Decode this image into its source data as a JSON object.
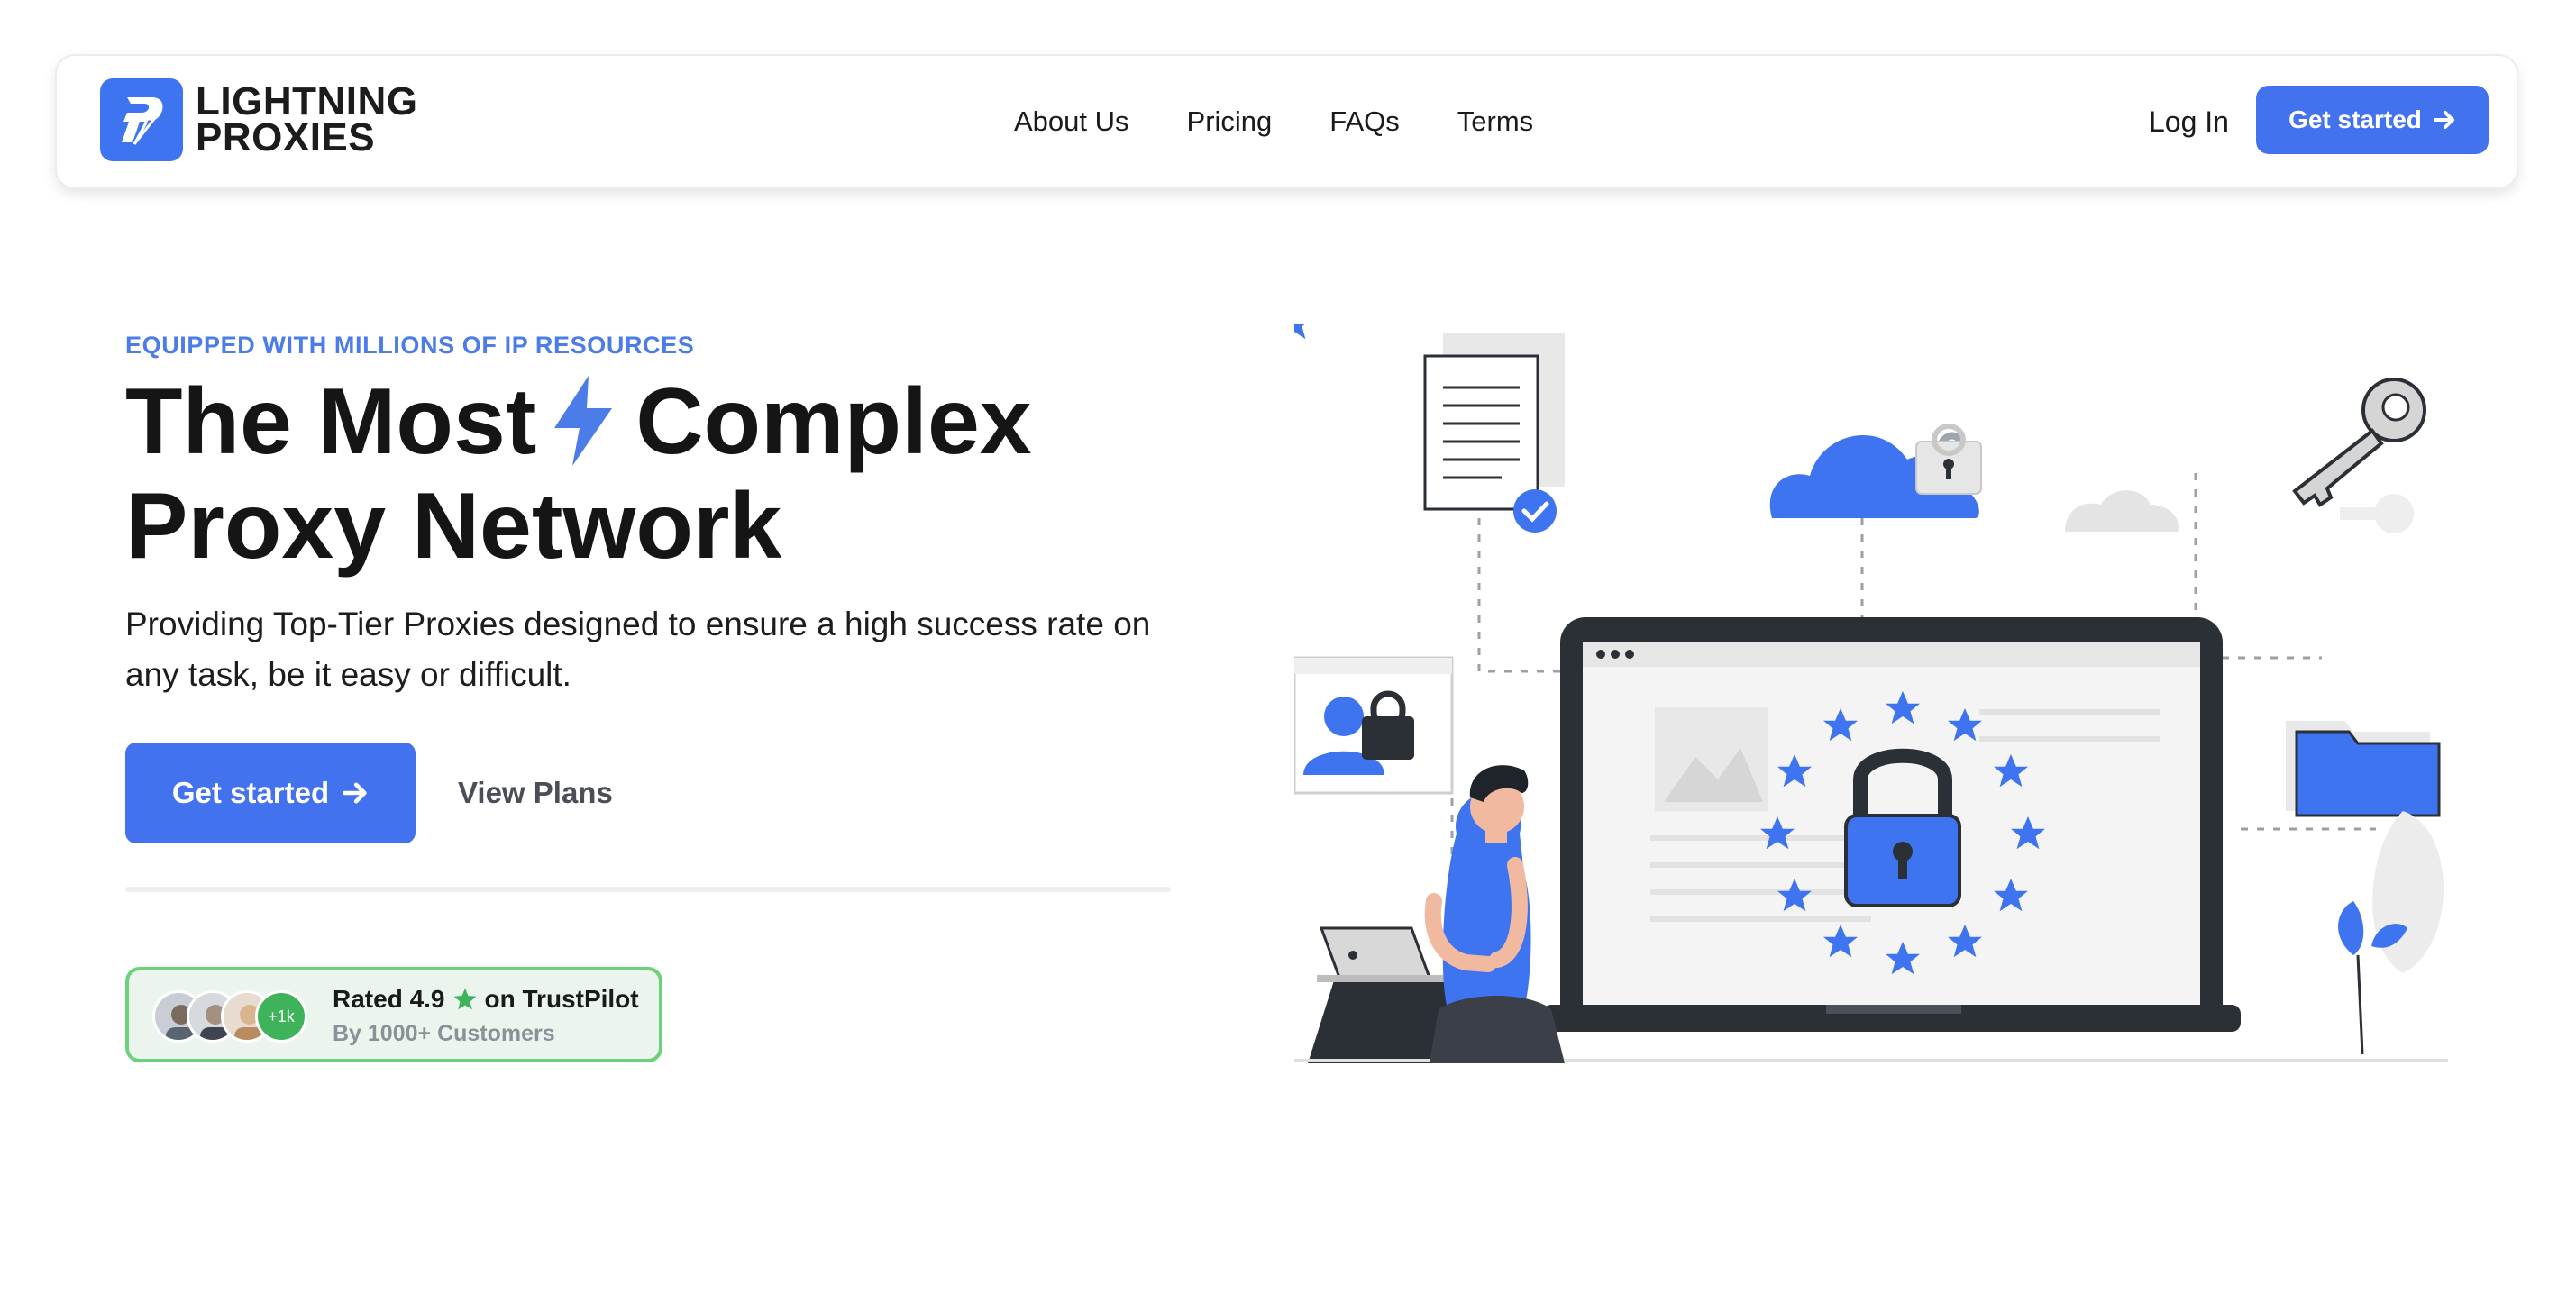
{
  "brand": {
    "name_line1": "LIGHTNING",
    "name_line2": "PROXIES",
    "accent": "#4372ee"
  },
  "nav": {
    "links": [
      "About Us",
      "Pricing",
      "FAQs",
      "Terms"
    ],
    "login": "Log In",
    "cta": "Get started"
  },
  "hero": {
    "eyebrow": "EQUIPPED WITH MILLIONS OF IP RESOURCES",
    "headline_part1": "The Most",
    "headline_part2": "Complex",
    "headline_line2": "Proxy Network",
    "subcopy": "Providing Top-Tier Proxies designed to ensure a high success rate on any task, be it easy or difficult.",
    "primary_cta": "Get started",
    "secondary_cta": "View Plans"
  },
  "trust": {
    "rated_prefix": "Rated 4.9",
    "rated_suffix": "on TrustPilot",
    "subtext": "By 1000+ Customers",
    "more_badge": "+1k",
    "star_color": "#3fb35c"
  },
  "icons": [
    "lightning-logo-icon",
    "arrow-right-icon",
    "bolt-icon",
    "star-icon"
  ]
}
